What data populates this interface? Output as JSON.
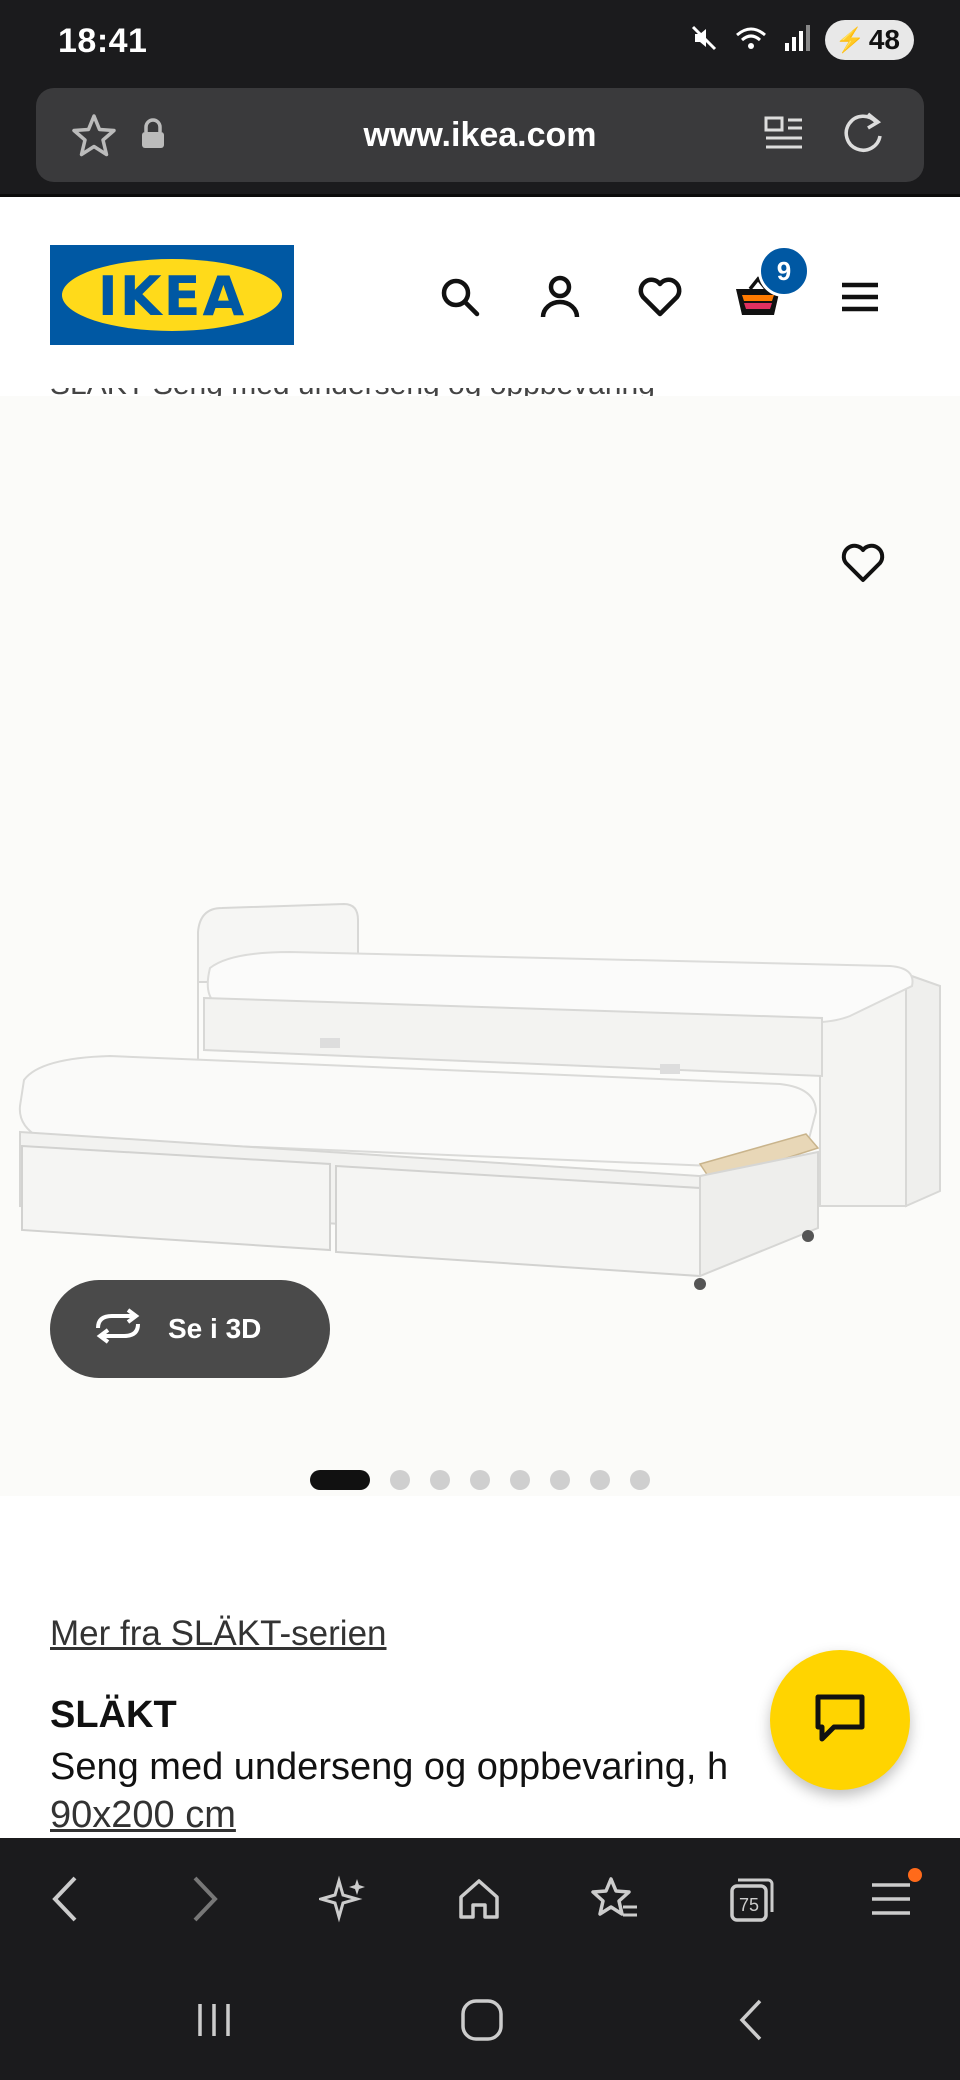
{
  "status_bar": {
    "time": "18:41",
    "battery": "48"
  },
  "browser": {
    "url": "www.ikea.com",
    "tab_count": "75"
  },
  "header": {
    "logo_text": "IKEA",
    "cart_count": "9"
  },
  "breadcrumb_text": "SLÄKT Seng med underseng og oppbevaring",
  "gallery": {
    "view_3d_label": "Se i 3D",
    "image_count": 8,
    "active_index": 0
  },
  "product": {
    "series_link": "Mer fra SLÄKT-serien",
    "name": "SLÄKT",
    "description": "Seng med underseng og oppbevaring, h",
    "size": "90x200 cm"
  },
  "colors": {
    "ikea_blue": "#0058a3",
    "ikea_yellow": "#ffda1a",
    "chat_yellow": "#ffd400"
  }
}
